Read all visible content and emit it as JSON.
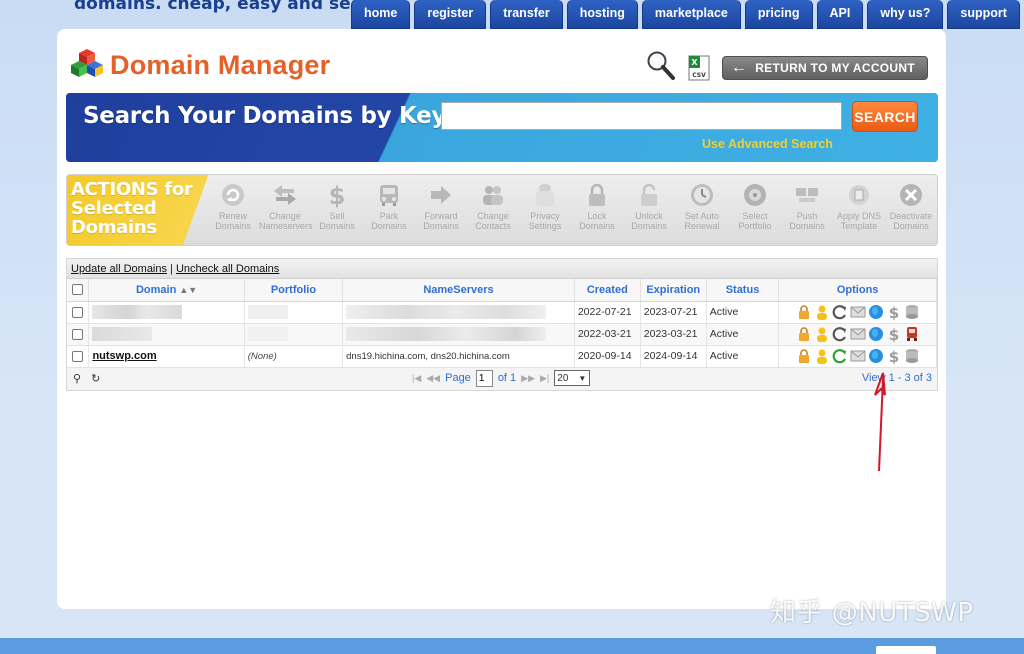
{
  "header": {
    "tagline": "domains. cheap, easy and secure.",
    "nav": [
      "home",
      "register",
      "transfer",
      "hosting",
      "marketplace",
      "pricing",
      "API",
      "why us?",
      "support"
    ]
  },
  "title": "Domain Manager",
  "return_button": "RETURN TO MY ACCOUNT",
  "search": {
    "title": "Search Your Domains by Keyword",
    "input_value": "",
    "button": "SEARCH",
    "advanced_link": "Use Advanced Search"
  },
  "actions": {
    "label_lines": [
      "ACTIONS for",
      "Selected",
      "Domains"
    ],
    "items": [
      {
        "icon": "renew-icon",
        "label": "Renew Domains"
      },
      {
        "icon": "change-nameservers-icon",
        "label": "Change Nameservers"
      },
      {
        "icon": "dollar-icon",
        "label": "Sell Domains"
      },
      {
        "icon": "park-icon",
        "label": "Park Domains"
      },
      {
        "icon": "forward-arrow-icon",
        "label": "Forward Domains"
      },
      {
        "icon": "contacts-icon",
        "label": "Change Contacts"
      },
      {
        "icon": "privacy-icon",
        "label": "Privacy Settings"
      },
      {
        "icon": "lock-icon",
        "label": "Lock Domains"
      },
      {
        "icon": "unlock-icon",
        "label": "Unlock Domains"
      },
      {
        "icon": "clock-icon",
        "label": "Set Auto Renewal"
      },
      {
        "icon": "portfolio-icon",
        "label": "Select Portfolio"
      },
      {
        "icon": "push-icon",
        "label": "Push Domains"
      },
      {
        "icon": "dns-template-icon",
        "label": "Apply DNS Template"
      },
      {
        "icon": "deactivate-icon",
        "label": "Deactivate Domains"
      }
    ]
  },
  "grid": {
    "update_all": "Update all Domains",
    "separator": "|",
    "uncheck_all": "Uncheck all Domains",
    "columns": [
      "Domain",
      "Portfolio",
      "NameServers",
      "Created",
      "Expiration",
      "Status",
      "Options"
    ],
    "rows": [
      {
        "domain": "",
        "portfolio": "",
        "nameservers": "",
        "created": "2022-07-21",
        "expiration": "2023-07-21",
        "status": "Active"
      },
      {
        "domain": "",
        "portfolio": "",
        "nameservers": "",
        "created": "2022-03-21",
        "expiration": "2023-03-21",
        "status": "Active"
      },
      {
        "domain": "nutswp.com",
        "portfolio": "(None)",
        "nameservers": "dns19.hichina.com, dns20.hichina.com",
        "created": "2020-09-14",
        "expiration": "2024-09-14",
        "status": "Active"
      }
    ],
    "pager": {
      "page_label": "Page",
      "page_value": "1",
      "of_label": "of 1",
      "per_page": "20",
      "view_text": "View 1 - 3 of 3"
    }
  },
  "watermark": "知乎 @NUTSWP",
  "colors": {
    "nav_blue": "#1c47a0",
    "title_orange": "#e4612a",
    "search_button": "#ea5a14",
    "advanced_link": "#f2cf2c",
    "actions_yellow": "#f4ca2b",
    "header_link_blue": "#2f6fd6",
    "annotation_red": "#d0182c"
  }
}
